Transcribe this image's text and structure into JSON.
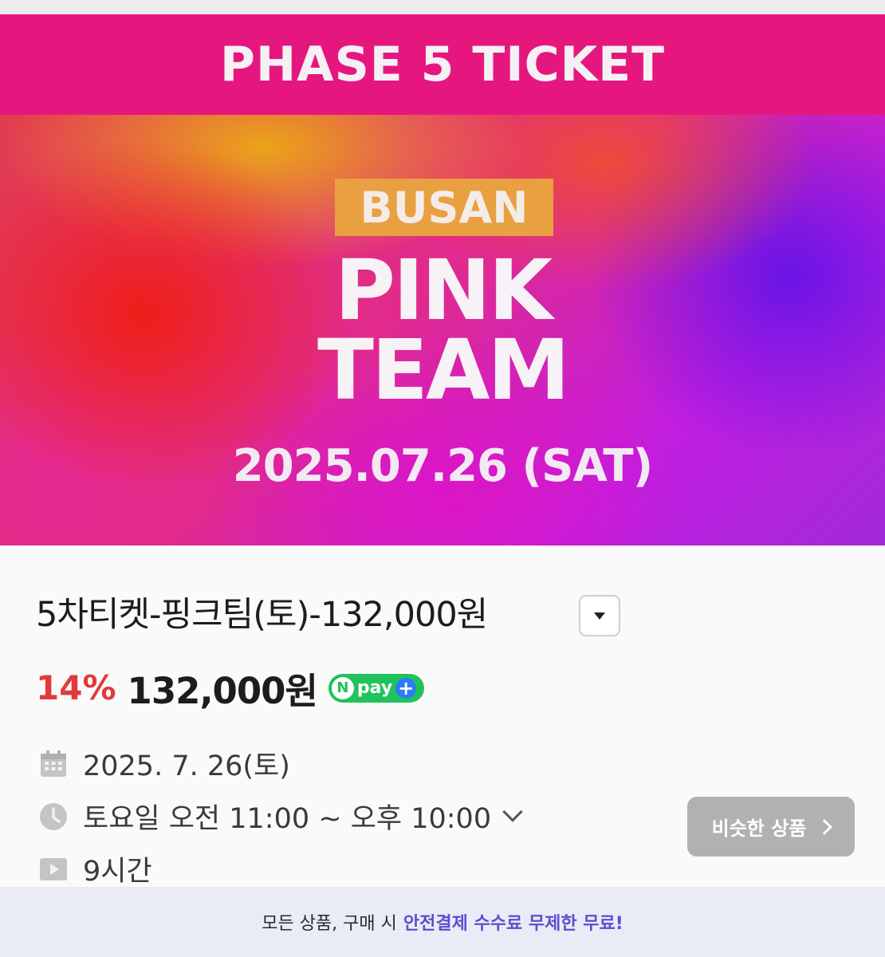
{
  "banner": {
    "header": "PHASE 5 TICKET",
    "city": "BUSAN",
    "team_line1": "PINK",
    "team_line2": "TEAM",
    "date": "2025.07.26 (SAT)"
  },
  "product": {
    "title": "5차티켓-핑크팀(토)-132,000원",
    "discount": "14%",
    "price": "132,000원",
    "npay_label": "pay",
    "npay_n": "N",
    "npay_plus": "+"
  },
  "meta": {
    "date": "2025. 7. 26(토)",
    "time": "토요일 오전 11:00 ~ 오후 10:00",
    "duration": "9시간",
    "icons": {
      "date": "calendar-icon",
      "time": "clock-icon",
      "duration": "play-icon"
    }
  },
  "similar_button": {
    "label": "비슷한 상품"
  },
  "footer": {
    "text": "모든 상품, 구매 시",
    "highlight": "안전결제 수수료 무제한 무료!"
  },
  "colors": {
    "header_pink": "#e5177f",
    "discount_red": "#e23a3a",
    "npay_green": "#20c25c",
    "footer_bg": "#e9ecf7",
    "footer_accent": "#5a4fcf"
  }
}
